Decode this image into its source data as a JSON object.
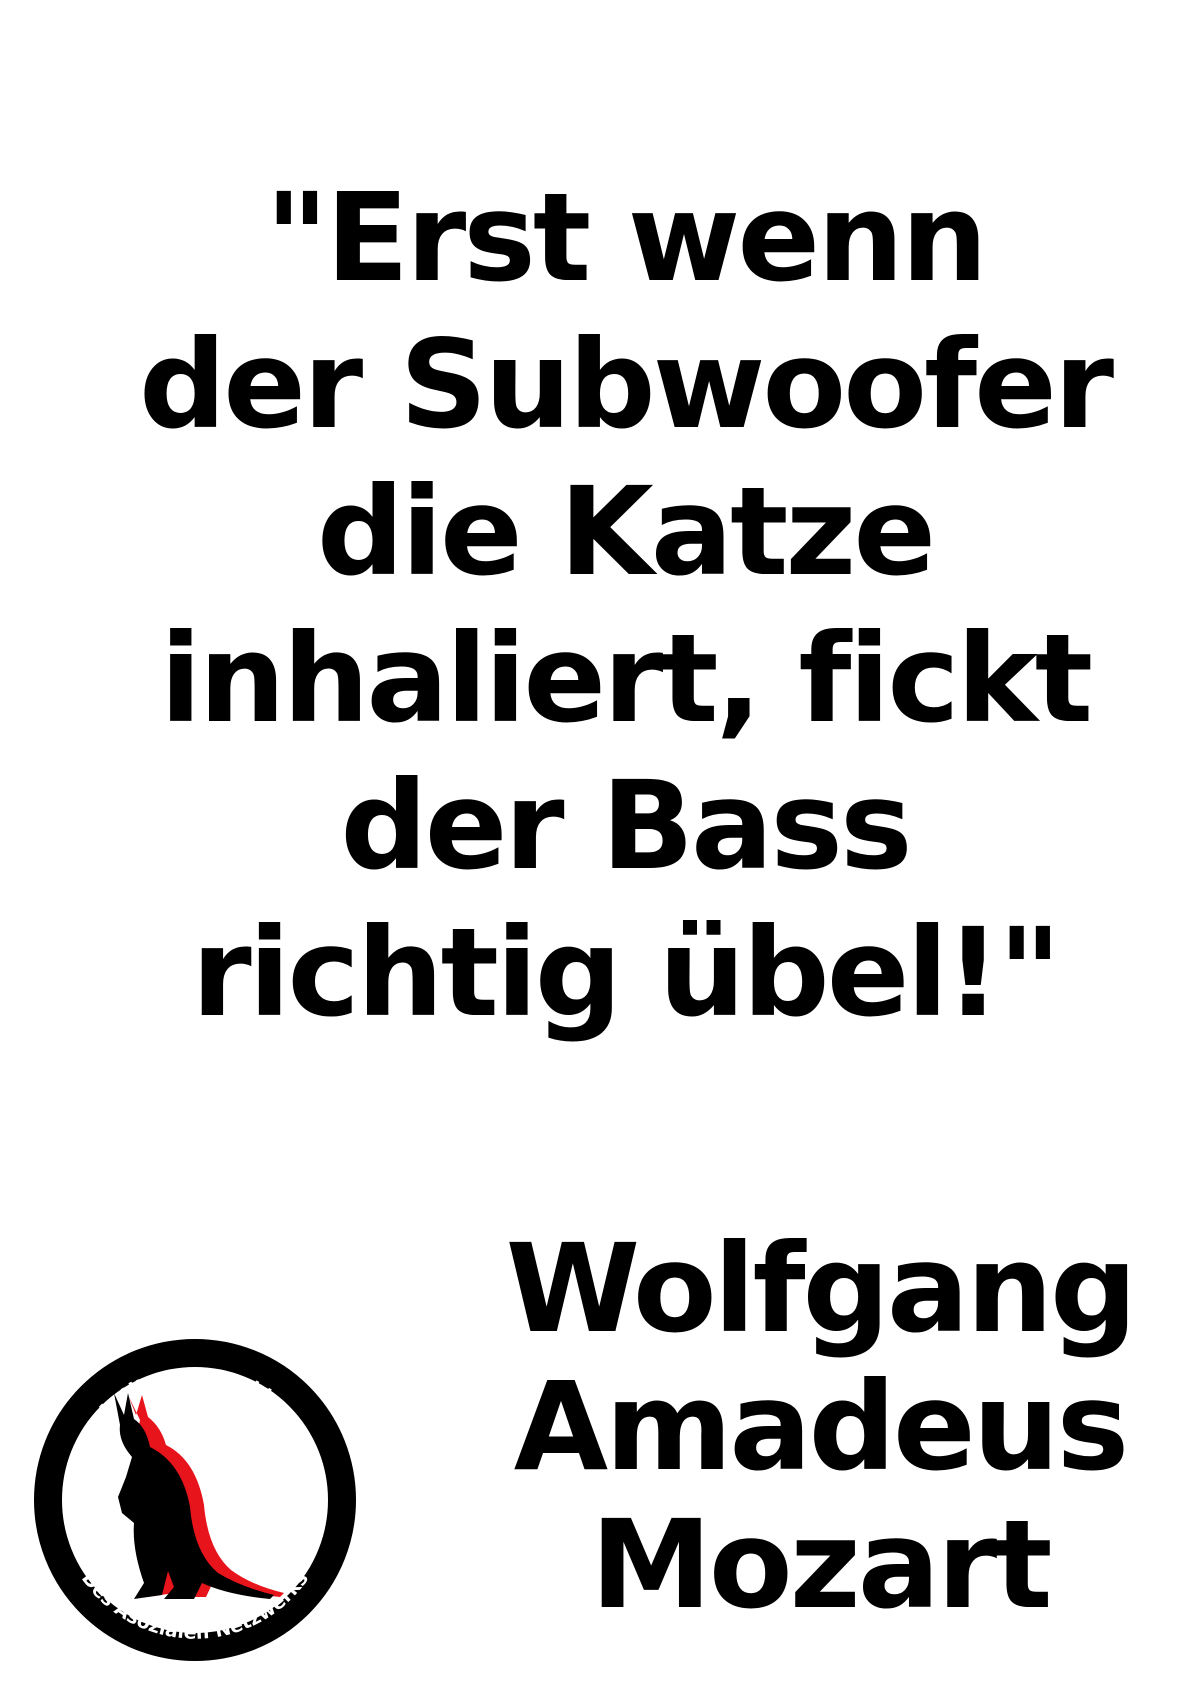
{
  "quote": {
    "lines": [
      "\"Erst wenn",
      "der Subwoofer",
      "die Katze",
      "inhaliert, fickt",
      "der Bass",
      "richtig übel!\""
    ]
  },
  "author": {
    "lines": [
      "Wolfgang",
      "Amadeus",
      "Mozart"
    ]
  },
  "logo": {
    "top_text": "Antiterroranschlag",
    "bottom_text": "Des Asozialen Netzwerks",
    "accent_color": "#e8141b"
  }
}
